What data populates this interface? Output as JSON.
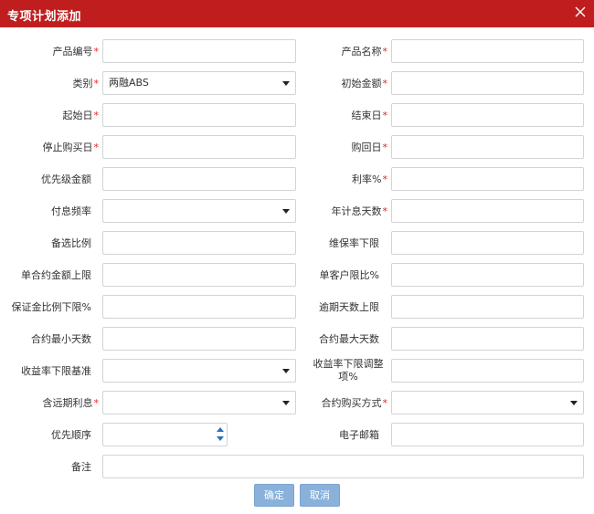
{
  "dialog": {
    "title": "专项计划添加",
    "close_icon": "close-icon"
  },
  "form": {
    "product_code": {
      "label": "产品编号",
      "required": "*",
      "value": ""
    },
    "product_name": {
      "label": "产品名称",
      "required": "*",
      "value": ""
    },
    "category": {
      "label": "类别",
      "required": "*",
      "value": "两融ABS"
    },
    "initial_amount": {
      "label": "初始金额",
      "required": "*",
      "value": ""
    },
    "start_date": {
      "label": "起始日",
      "required": "*",
      "value": ""
    },
    "end_date": {
      "label": "结束日",
      "required": "*",
      "value": ""
    },
    "stop_buy_date": {
      "label": "停止购买日",
      "required": "*",
      "value": ""
    },
    "buyback_date": {
      "label": "购回日",
      "required": "*",
      "value": ""
    },
    "senior_amount": {
      "label": "优先级金额",
      "value": ""
    },
    "interest_rate": {
      "label": "利率%",
      "required": "*",
      "value": ""
    },
    "payment_frequency": {
      "label": "付息频率",
      "value": ""
    },
    "annual_days": {
      "label": "年计息天数",
      "required": "*",
      "value": ""
    },
    "reserve_ratio": {
      "label": "备选比例",
      "value": ""
    },
    "maintenance_floor": {
      "label": "维保率下限",
      "value": ""
    },
    "single_contract_cap": {
      "label": "单合约金额上限",
      "value": ""
    },
    "single_client_ratio": {
      "label": "单客户限比%",
      "value": ""
    },
    "margin_floor": {
      "label": "保证金比例下限%",
      "value": ""
    },
    "overdue_days_cap": {
      "label": "逾期天数上限",
      "value": ""
    },
    "contract_min_days": {
      "label": "合约最小天数",
      "value": ""
    },
    "contract_max_days": {
      "label": "合约最大天数",
      "value": ""
    },
    "yield_floor_basis": {
      "label": "收益率下限基准",
      "value": ""
    },
    "yield_floor_adjust": {
      "label": "收益率下限调整项%",
      "value": ""
    },
    "include_forward_interest": {
      "label": "含远期利息",
      "required": "*",
      "value": ""
    },
    "contract_buy_method": {
      "label": "合约购买方式",
      "required": "*",
      "value": ""
    },
    "priority_order": {
      "label": "优先顺序",
      "value": ""
    },
    "email": {
      "label": "电子邮箱",
      "value": ""
    },
    "remarks": {
      "label": "备注",
      "value": ""
    }
  },
  "buttons": {
    "confirm": "确定",
    "cancel": "取消"
  },
  "colors": {
    "titlebar": "#c01e1e",
    "required": "#d9262c",
    "button": "#8ab1da",
    "spinner": "#2a6fc0"
  }
}
